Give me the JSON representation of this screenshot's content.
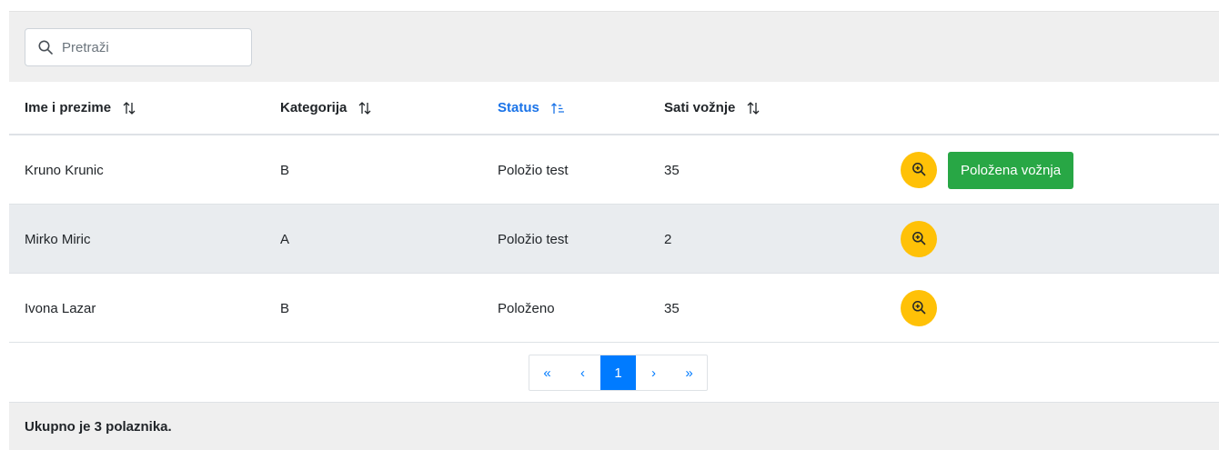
{
  "search": {
    "placeholder": "Pretraži",
    "value": ""
  },
  "table": {
    "columns": [
      {
        "label": "Ime i prezime",
        "sort": "none"
      },
      {
        "label": "Kategorija",
        "sort": "none"
      },
      {
        "label": "Status",
        "sort": "asc"
      },
      {
        "label": "Sati vožnje",
        "sort": "none"
      }
    ],
    "rows": [
      {
        "name": "Kruno Krunic",
        "category": "B",
        "status": "Položio test",
        "hours": "35",
        "action_label": "Položena vožnja"
      },
      {
        "name": "Mirko Miric",
        "category": "A",
        "status": "Položio test",
        "hours": "2"
      },
      {
        "name": "Ivona Lazar",
        "category": "B",
        "status": "Položeno",
        "hours": "35"
      }
    ]
  },
  "pagination": {
    "first": "«",
    "prev": "‹",
    "current": "1",
    "next": "›",
    "last": "»"
  },
  "footer": {
    "summary": "Ukupno je 3 polaznika."
  },
  "icons": {
    "search": "search-icon",
    "sort": "sort-icon",
    "sort_asc": "sort-ascending-icon",
    "view": "zoom-in-icon"
  },
  "colors": {
    "accent": "#007bff",
    "warning": "#ffc107",
    "success": "#28a745",
    "active_header": "#1a73e8",
    "stripe": "#e9ecef",
    "toolbar_bg": "#efefef"
  }
}
